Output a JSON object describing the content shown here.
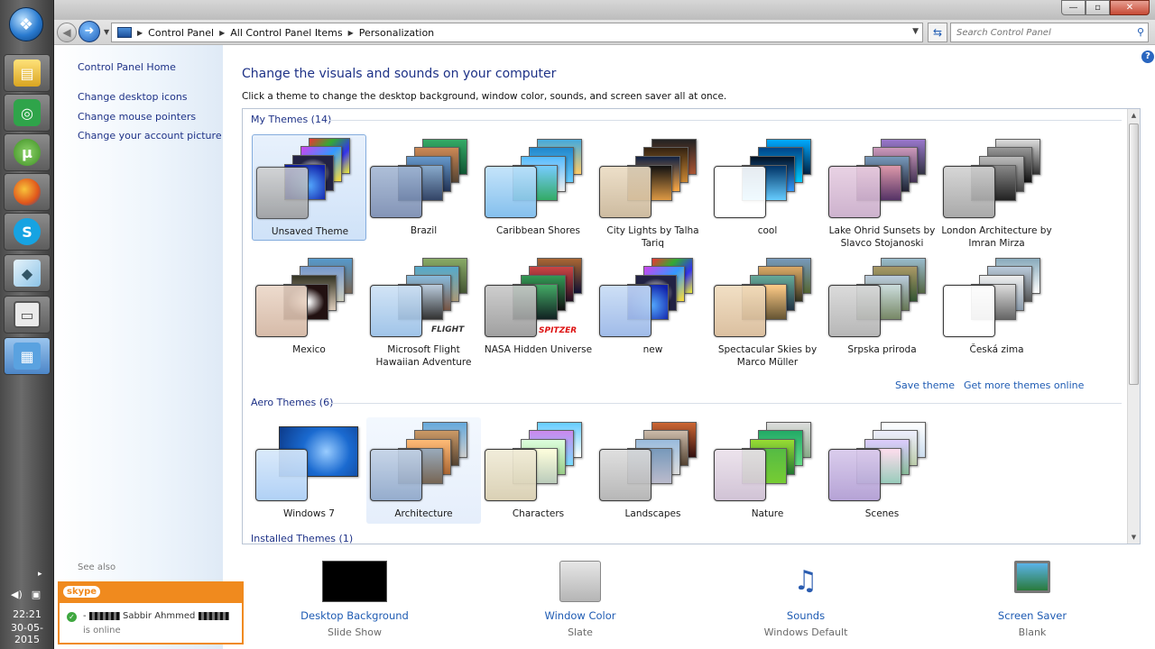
{
  "taskbar": {
    "time": "22:21",
    "date": "30-05-2015",
    "apps": [
      "start-orb",
      "file-manager",
      "qq",
      "utorrent",
      "firefox",
      "skype",
      "notepad",
      "control-panel-window",
      "remote-desktop"
    ]
  },
  "window": {
    "breadcrumbs": [
      "Control Panel",
      "All Control Panel Items",
      "Personalization"
    ],
    "search_placeholder": "Search Control Panel"
  },
  "sidebar": {
    "items": [
      {
        "label": "Control Panel Home"
      },
      {
        "label": "Change desktop icons"
      },
      {
        "label": "Change mouse pointers"
      },
      {
        "label": "Change your account picture"
      }
    ],
    "see_also": "See also"
  },
  "main": {
    "title": "Change the visuals and sounds on your computer",
    "subtitle": "Click a theme to change the desktop background, window color, sounds, and screen saver all at once."
  },
  "groups": {
    "my_themes": {
      "header": "My Themes (14)",
      "items": [
        {
          "label": "Unsaved Theme",
          "selected": true
        },
        {
          "label": "Brazil"
        },
        {
          "label": "Caribbean Shores"
        },
        {
          "label": "City Lights by Talha Tariq"
        },
        {
          "label": "cool"
        },
        {
          "label": "Lake Ohrid Sunsets by Slavco Stojanoski"
        },
        {
          "label": "London Architecture by Imran Mirza"
        },
        {
          "label": "Mexico"
        },
        {
          "label": "Microsoft Flight Hawaiian Adventure",
          "badge": "FLIGHT"
        },
        {
          "label": "NASA Hidden Universe",
          "badge": "SPITZER"
        },
        {
          "label": "new"
        },
        {
          "label": "Spectacular Skies by Marco Müller"
        },
        {
          "label": "Srpska priroda"
        },
        {
          "label": "Česká zima"
        }
      ]
    },
    "aero_themes": {
      "header": "Aero Themes (6)",
      "items": [
        {
          "label": "Windows 7"
        },
        {
          "label": "Architecture"
        },
        {
          "label": "Characters"
        },
        {
          "label": "Landscapes"
        },
        {
          "label": "Nature"
        },
        {
          "label": "Scenes"
        }
      ]
    },
    "installed_themes": {
      "header": "Installed Themes (1)"
    }
  },
  "links": {
    "save_theme": "Save theme",
    "get_more": "Get more themes online"
  },
  "bottom": [
    {
      "title": "Desktop Background",
      "sub": "Slide Show"
    },
    {
      "title": "Window Color",
      "sub": "Slate"
    },
    {
      "title": "Sounds",
      "sub": "Windows Default"
    },
    {
      "title": "Screen Saver",
      "sub": "Blank"
    }
  ],
  "skype_popup": {
    "logo": "skype",
    "name": "Sabbir  Ahmmed",
    "status": "is online"
  },
  "colors": {
    "link": "#1e5bb3",
    "heading": "#1e3287",
    "skype_orange": "#f08a1e"
  }
}
